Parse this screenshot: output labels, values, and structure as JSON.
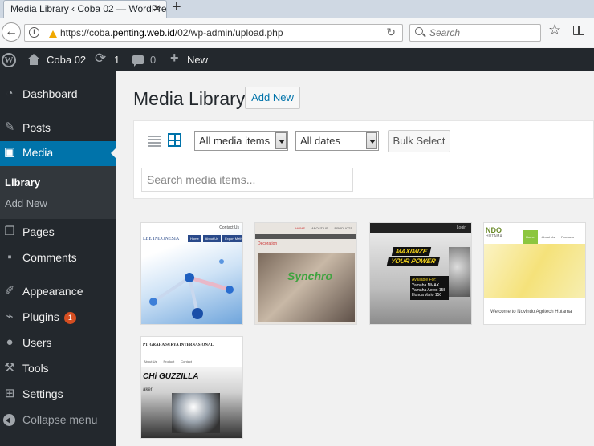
{
  "browser": {
    "tab_title": "Media Library ‹ Coba 02 — WordPress",
    "url_prefix": "https://coba.",
    "url_domain": "penting.web.id",
    "url_path": "/02/wp-admin/upload.php",
    "search_placeholder": "Search"
  },
  "admin_bar": {
    "site_name": "Coba 02",
    "updates_count": "1",
    "comments_count": "0",
    "new_label": "New"
  },
  "sidebar": {
    "items": [
      {
        "label": "Dashboard"
      },
      {
        "label": "Posts"
      },
      {
        "label": "Media"
      },
      {
        "label": "Pages"
      },
      {
        "label": "Comments"
      },
      {
        "label": "Appearance"
      },
      {
        "label": "Plugins",
        "badge": "1"
      },
      {
        "label": "Users"
      },
      {
        "label": "Tools"
      },
      {
        "label": "Settings"
      },
      {
        "label": "Collapse menu"
      }
    ],
    "submenu": [
      {
        "label": "Library"
      },
      {
        "label": "Add New"
      }
    ]
  },
  "main": {
    "title": "Media Library",
    "add_new_label": "Add New",
    "filter_type": "All media items",
    "filter_date": "All dates",
    "bulk_select_label": "Bulk Select",
    "search_placeholder": "Search media items..."
  },
  "thumbnails": {
    "t1": {
      "top": "Contact Us",
      "brand": "LEE INDONESIA",
      "nav": [
        "Home",
        "About Us",
        "Export Methods"
      ]
    },
    "t2": {
      "nav": [
        "HOME",
        "ABOUT US",
        "PRODUCTS"
      ],
      "caption": "Decoration",
      "logo": "Synchro"
    },
    "t3": {
      "top": "Login",
      "banner1": "MAXIMIZE",
      "banner2": "YOUR POWER",
      "badge": "Available For:",
      "models": [
        "Yamaha NMAX",
        "Yamaha Aerox 155",
        "Honda Vario 150"
      ]
    },
    "t4": {
      "brand": "NDO",
      "sub": "HUTAMA",
      "nav": [
        "Home",
        "About Us",
        "Products"
      ],
      "welcome": "Welcome to Novindo Agritech Hutama"
    },
    "t5": {
      "brand": "PT. GRAHA SURYA INTERNASIONAL",
      "nav": [
        "About Us",
        "Product",
        "Contact"
      ],
      "logo": "CHi GUZZILLA",
      "sub": "aker"
    }
  },
  "colors": {
    "admin_dark": "#23282d",
    "active_blue": "#0073aa",
    "badge_orange": "#d54e21"
  }
}
